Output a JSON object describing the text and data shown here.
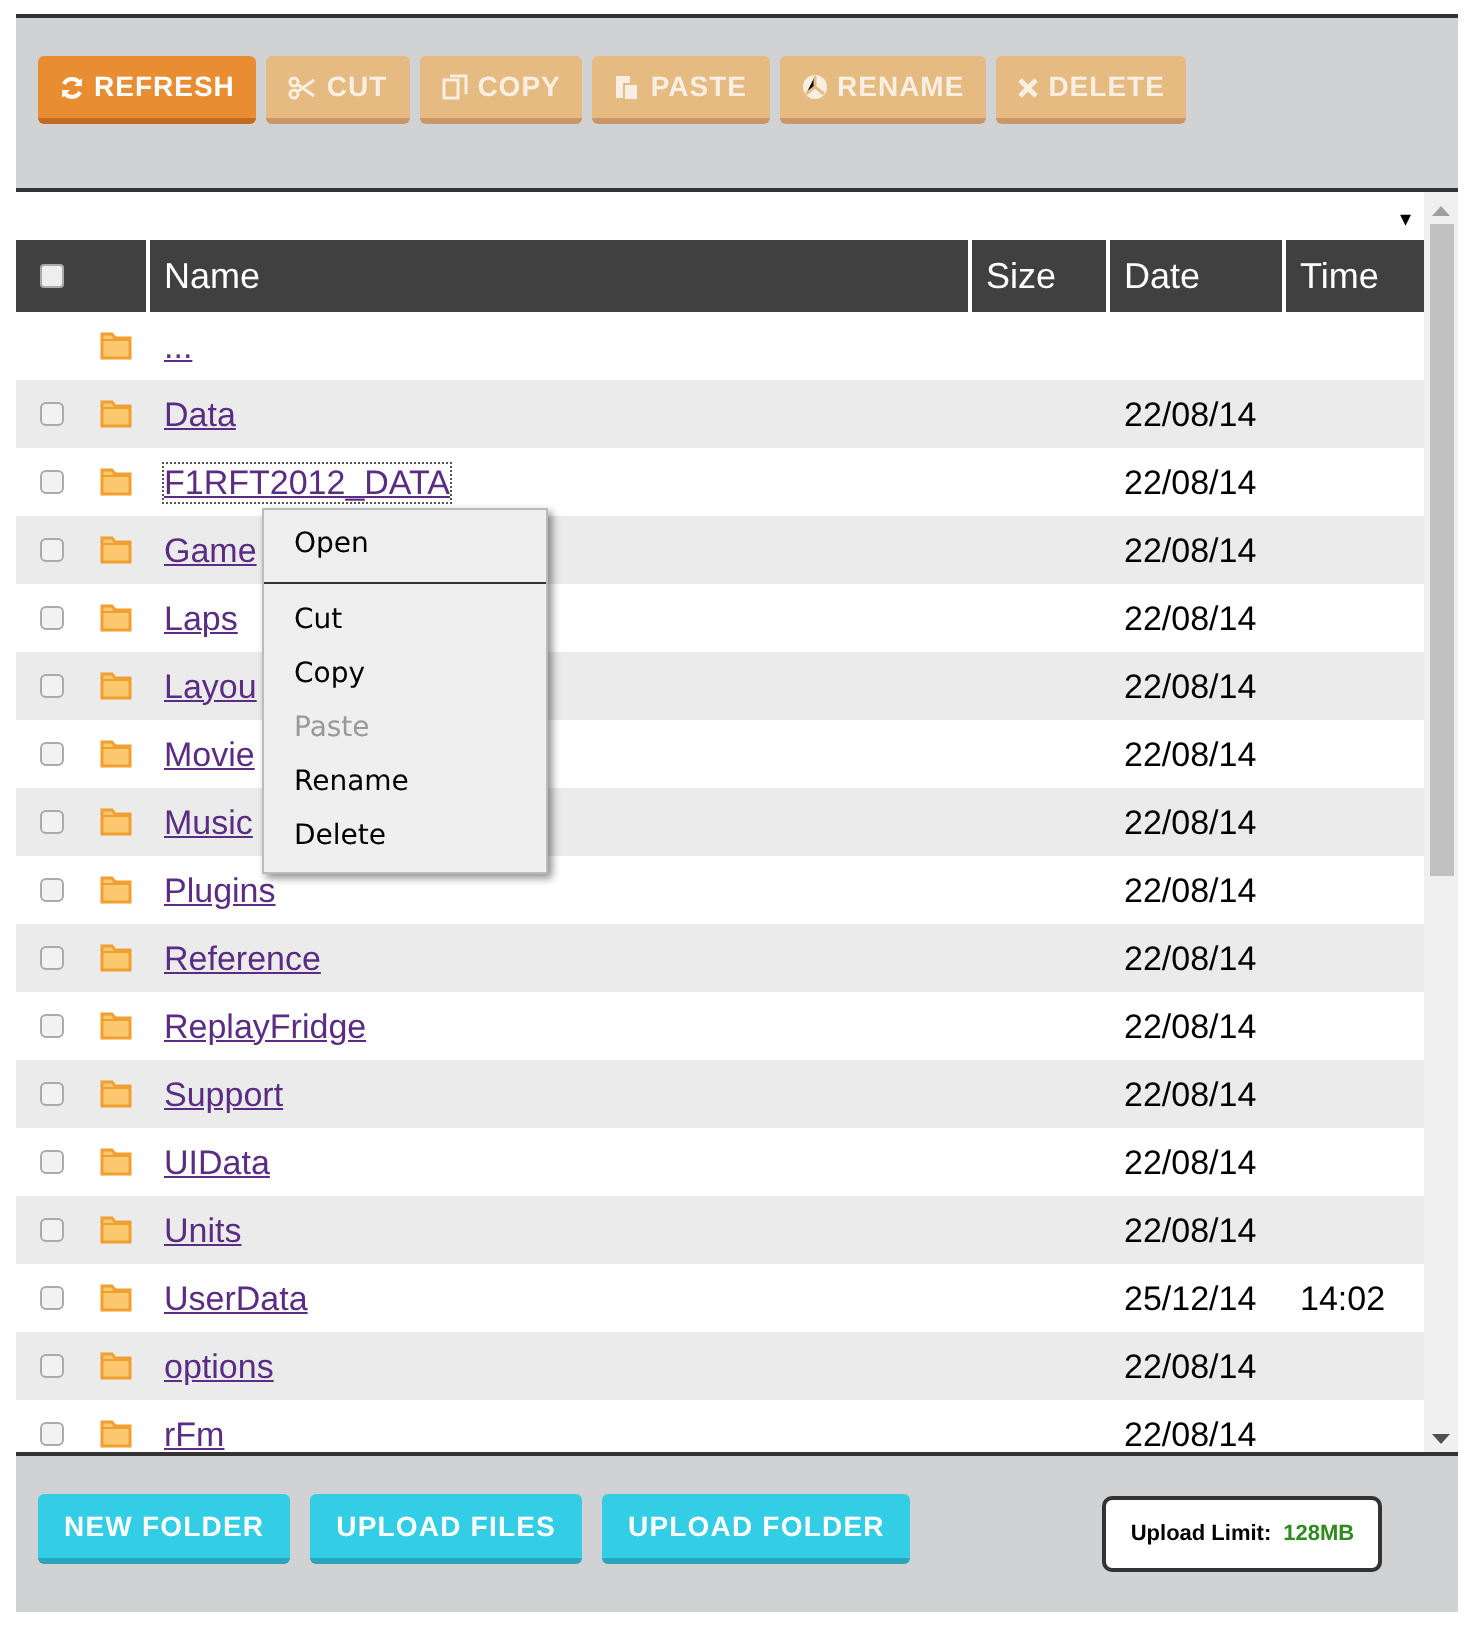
{
  "toolbar": {
    "buttons": [
      {
        "label": "REFRESH",
        "disabled": false
      },
      {
        "label": "CUT",
        "disabled": true
      },
      {
        "label": "COPY",
        "disabled": true
      },
      {
        "label": "PASTE",
        "disabled": true
      },
      {
        "label": "RENAME",
        "disabled": true
      },
      {
        "label": "DELETE",
        "disabled": true
      }
    ]
  },
  "dropdown": {
    "caret": "▾"
  },
  "table": {
    "columns": [
      "Name",
      "Size",
      "Date",
      "Time"
    ],
    "select_all": {
      "checked": false
    },
    "rows": [
      {
        "kind": "parent",
        "name": "...",
        "focused": false
      },
      {
        "kind": "folder",
        "name": "Data",
        "checked": false,
        "date": "22/08/14",
        "focused": false
      },
      {
        "kind": "folder",
        "name": "F1RFT2012_DATA",
        "checked": false,
        "date": "22/08/14",
        "focused": true
      },
      {
        "kind": "folder",
        "name": "Game",
        "checked": false,
        "date": "22/08/14",
        "focused": false
      },
      {
        "kind": "folder",
        "name": "Laps",
        "checked": false,
        "date": "22/08/14",
        "focused": false
      },
      {
        "kind": "folder",
        "name": "Layou",
        "checked": false,
        "date": "22/08/14",
        "focused": false
      },
      {
        "kind": "folder",
        "name": "Movie",
        "checked": false,
        "date": "22/08/14",
        "focused": false
      },
      {
        "kind": "folder",
        "name": "Music",
        "checked": false,
        "date": "22/08/14",
        "focused": false
      },
      {
        "kind": "folder",
        "name": "Plugins",
        "checked": false,
        "date": "22/08/14",
        "focused": false
      },
      {
        "kind": "folder",
        "name": "Reference",
        "checked": false,
        "date": "22/08/14",
        "focused": false
      },
      {
        "kind": "folder",
        "name": "ReplayFridge",
        "checked": false,
        "date": "22/08/14",
        "focused": false
      },
      {
        "kind": "folder",
        "name": "Support",
        "checked": false,
        "date": "22/08/14",
        "focused": false
      },
      {
        "kind": "folder",
        "name": "UIData",
        "checked": false,
        "date": "22/08/14",
        "focused": false
      },
      {
        "kind": "folder",
        "name": "Units",
        "checked": false,
        "date": "22/08/14",
        "focused": false
      },
      {
        "kind": "folder",
        "name": "UserData",
        "checked": false,
        "date": "25/12/14",
        "time": "14:02",
        "focused": false
      },
      {
        "kind": "folder",
        "name": "options",
        "checked": false,
        "date": "22/08/14",
        "focused": false
      },
      {
        "kind": "folder",
        "name": "rFm",
        "checked": false,
        "date": "22/08/14",
        "focused": false
      }
    ]
  },
  "context_menu": {
    "items": [
      {
        "label": "Open",
        "disabled": false,
        "separator_after": true
      },
      {
        "label": "Cut",
        "disabled": false,
        "separator_after": false
      },
      {
        "label": "Copy",
        "disabled": false,
        "separator_after": false
      },
      {
        "label": "Paste",
        "disabled": true,
        "separator_after": false
      },
      {
        "label": "Rename",
        "disabled": false,
        "separator_after": false
      },
      {
        "label": "Delete",
        "disabled": false,
        "separator_after": false
      }
    ]
  },
  "footer": {
    "buttons": [
      "NEW FOLDER",
      "UPLOAD FILES",
      "UPLOAD FOLDER"
    ],
    "upload_limit": {
      "label": "Upload Limit:",
      "value": "128MB"
    }
  }
}
